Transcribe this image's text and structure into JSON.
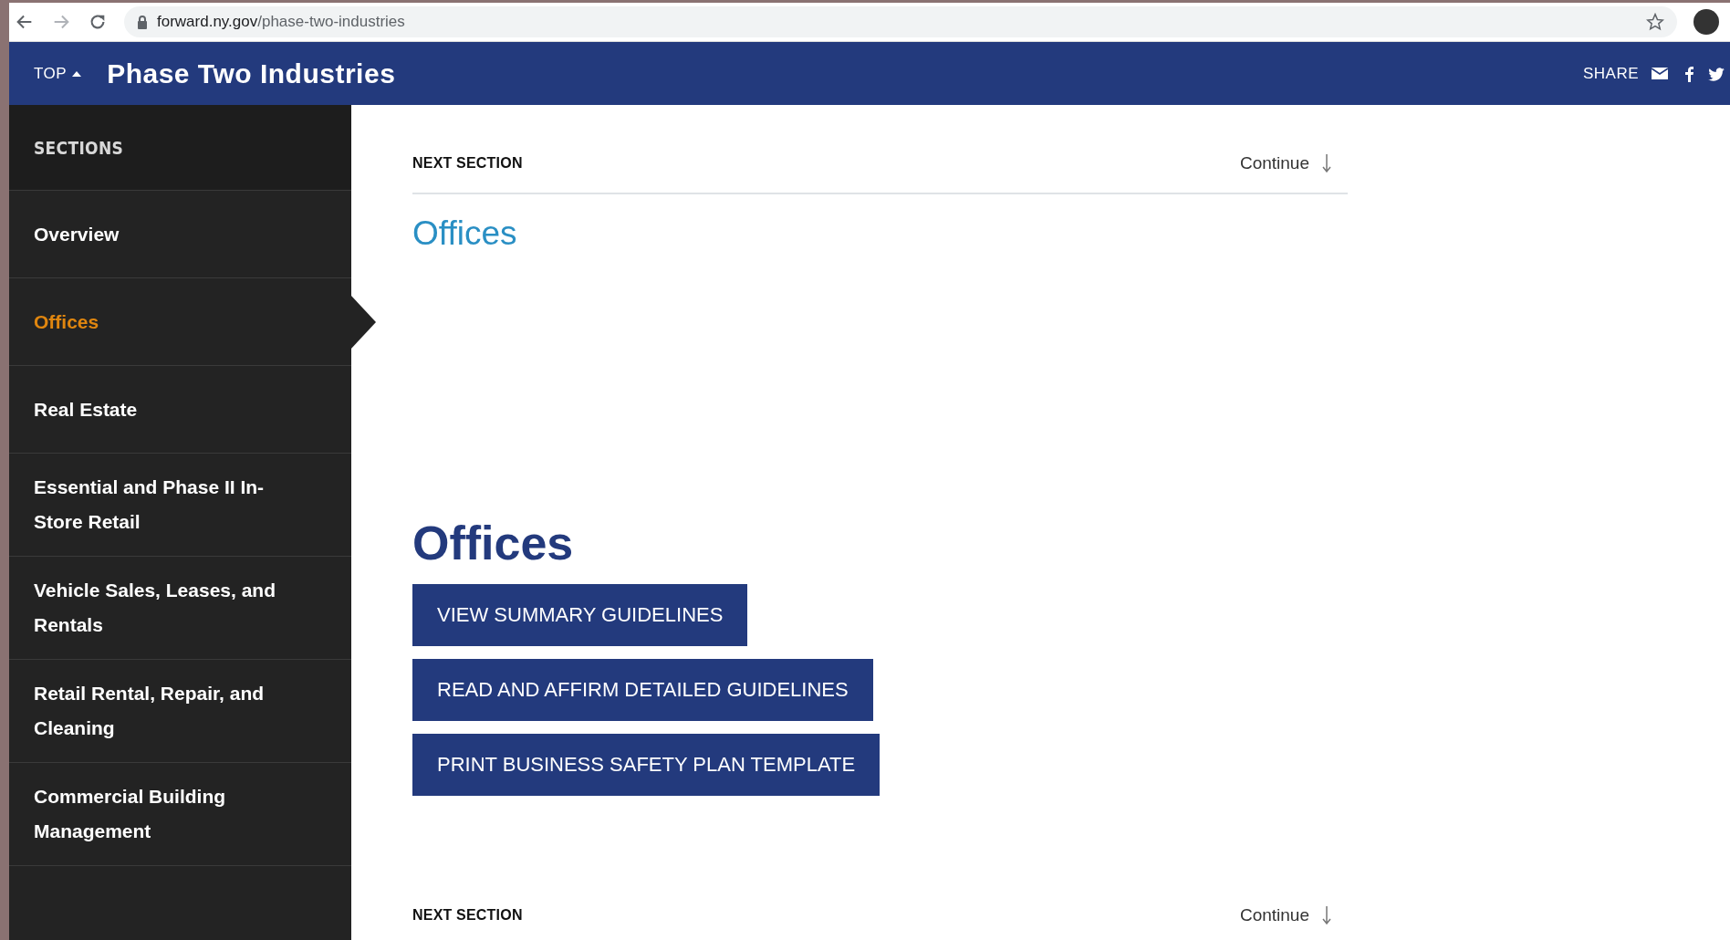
{
  "browser": {
    "url_host": "forward.ny.gov",
    "url_path": "/phase-two-industries"
  },
  "header": {
    "top_label": "TOP",
    "title": "Phase Two Industries",
    "share_label": "SHARE"
  },
  "sidebar": {
    "heading": "SECTIONS",
    "items": [
      {
        "label": "Overview",
        "selected": false
      },
      {
        "label": "Offices",
        "selected": true
      },
      {
        "label": "Real Estate",
        "selected": false
      },
      {
        "label": "Essential and Phase II In-Store Retail",
        "selected": false
      },
      {
        "label": "Vehicle Sales, Leases, and Rentals",
        "selected": false
      },
      {
        "label": "Retail Rental, Repair, and Cleaning",
        "selected": false
      },
      {
        "label": "Commercial Building Management",
        "selected": false
      }
    ]
  },
  "content": {
    "next_top": {
      "label": "NEXT SECTION",
      "continue": "Continue"
    },
    "section_link": "Offices",
    "heading": "Offices",
    "buttons": [
      "VIEW SUMMARY GUIDELINES",
      "READ AND AFFIRM DETAILED GUIDELINES",
      "PRINT BUSINESS SAFETY PLAN TEMPLATE"
    ],
    "next_bottom": {
      "label": "NEXT SECTION",
      "continue": "Continue"
    }
  }
}
